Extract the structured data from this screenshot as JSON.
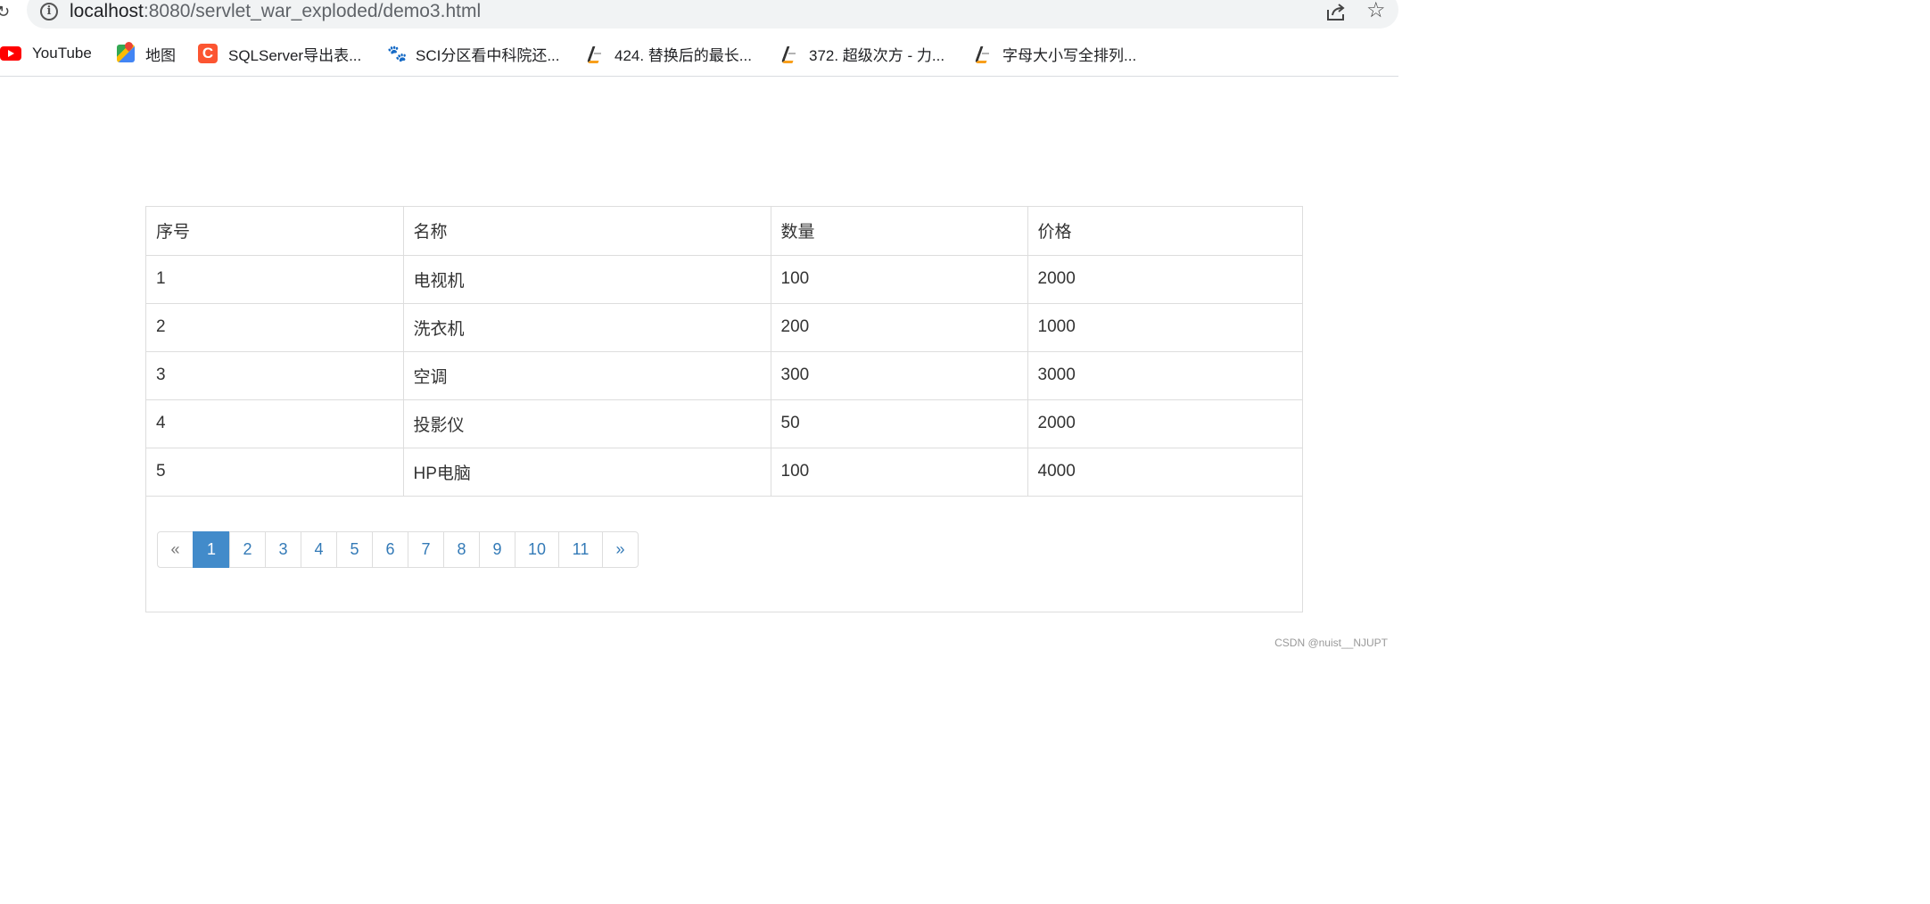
{
  "address_bar": {
    "host": "localhost",
    "path": ":8080/servlet_war_exploded/demo3.html"
  },
  "bookmarks": [
    {
      "label": "YouTube",
      "icon": "youtube-icon"
    },
    {
      "label": "地图",
      "icon": "maps-icon"
    },
    {
      "label": "SQLServer导出表...",
      "icon": "csdn-icon"
    },
    {
      "label": "SCI分区看中科院还...",
      "icon": "baidu-icon"
    },
    {
      "label": "424. 替换后的最长...",
      "icon": "leetcode-icon"
    },
    {
      "label": "372. 超级次方 - 力...",
      "icon": "leetcode-icon"
    },
    {
      "label": "字母大小写全排列...",
      "icon": "leetcode-icon"
    }
  ],
  "table": {
    "headers": [
      "序号",
      "名称",
      "数量",
      "价格"
    ],
    "rows": [
      [
        "1",
        "电视机",
        "100",
        "2000"
      ],
      [
        "2",
        "洗衣机",
        "200",
        "1000"
      ],
      [
        "3",
        "空调",
        "300",
        "3000"
      ],
      [
        "4",
        "投影仪",
        "50",
        "2000"
      ],
      [
        "5",
        "HP电脑",
        "100",
        "4000"
      ]
    ]
  },
  "pagination": {
    "prev": "«",
    "next": "»",
    "pages": [
      "1",
      "2",
      "3",
      "4",
      "5",
      "6",
      "7",
      "8",
      "9",
      "10",
      "11"
    ],
    "active": "1"
  },
  "watermark": "CSDN @nuist__NJUPT",
  "colors": {
    "active_page": "#428bca",
    "link": "#337ab7",
    "border": "#dddddd"
  }
}
